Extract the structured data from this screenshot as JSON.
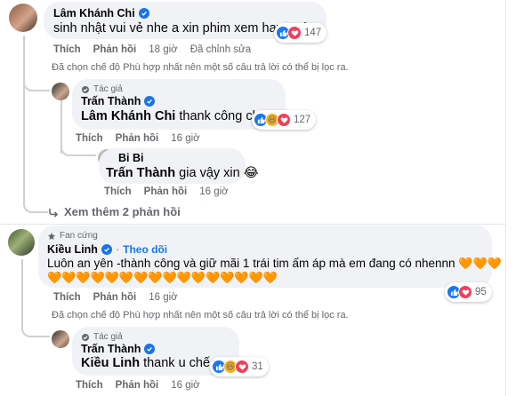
{
  "comments": [
    {
      "author": "Lâm Khánh Chi",
      "text": "sinh nhật vui vẻ nhe a xin phim xem hay quá",
      "actions": {
        "like": "Thích",
        "reply": "Phản hồi",
        "time": "18 giờ",
        "edited": "Đã chỉnh sửa"
      },
      "reactions": {
        "count": "147"
      },
      "filter_note": "Đã chọn chế độ Phù hợp nhất nên một số câu trả lời có thể bị lọc ra.",
      "replies": [
        {
          "badge": "Tác giả",
          "author": "Trấn Thành",
          "mention": "Lâm Khánh Chi",
          "text": " thank công chúa!",
          "actions": {
            "like": "Thích",
            "reply": "Phản hồi",
            "time": "16 giờ"
          },
          "reactions": {
            "count": "127"
          }
        },
        {
          "author": "Bi Bi",
          "mention": "Trấn Thành",
          "text": " gia vậy xin",
          "emoji": "😂",
          "actions": {
            "like": "Thích",
            "reply": "Phản hồi",
            "time": "16 giờ"
          }
        }
      ],
      "more_replies": "Xem thêm 2 phản hồi"
    },
    {
      "badge": "Fan cứng",
      "author": "Kiều Linh",
      "follow": "Theo dõi",
      "text": "Luôn an yên -thành công và giữ mãi 1 trái tim ấm áp mà em đang có nhennn",
      "hearts_line1": "🧡🧡🧡",
      "hearts_line2": "🧡🧡🧡🧡🧡🧡🧡🧡🧡🧡🧡🧡🧡🧡🧡🧡",
      "actions": {
        "like": "Thích",
        "reply": "Phản hồi",
        "time": "16 giờ"
      },
      "reactions": {
        "count": "95"
      },
      "filter_note": "Đã chọn chế độ Phù hợp nhất nên một số câu trả lời có thể bị lọc ra.",
      "replies": [
        {
          "badge": "Tác giả",
          "author": "Trấn Thành",
          "mention": "Kiều Linh",
          "text": " thank u chế yêu",
          "actions": {
            "like": "Thích",
            "reply": "Phản hồi",
            "time": "16 giờ"
          },
          "reactions": {
            "count": "31"
          }
        }
      ]
    }
  ],
  "colors": {
    "bubble": "#f0f2f5",
    "meta": "#65676b",
    "blue": "#1877f2",
    "verified": "#1b74e4"
  },
  "icons": [
    "verified-icon",
    "reply-arrow-icon",
    "like-icon",
    "love-icon",
    "haha-icon"
  ]
}
